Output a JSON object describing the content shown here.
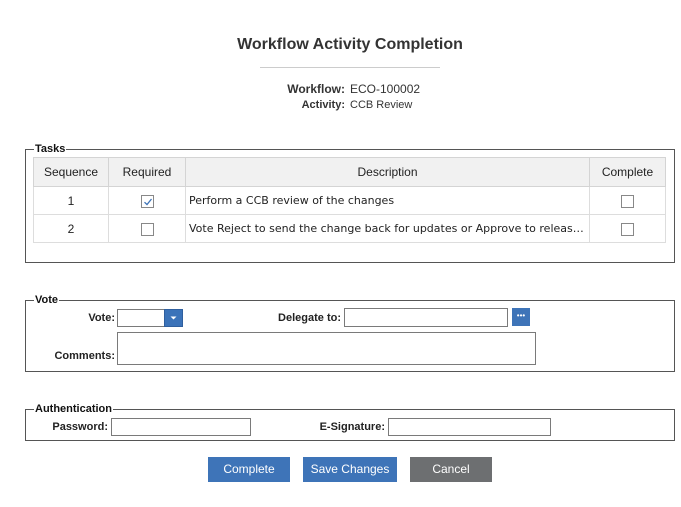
{
  "header": {
    "title": "Workflow Activity Completion",
    "workflow_label": "Workflow:",
    "workflow_value": "ECO-100002",
    "activity_label": "Activity:",
    "activity_value": "CCB Review"
  },
  "tasks": {
    "legend": "Tasks",
    "columns": [
      "Sequence",
      "Required",
      "Description",
      "Complete"
    ],
    "rows": [
      {
        "sequence": "1",
        "required": true,
        "description": "Perform a CCB review of the changes",
        "complete": false
      },
      {
        "sequence": "2",
        "required": false,
        "description": "Vote Reject to send the change back for updates or Approve to release t…",
        "complete": false
      }
    ]
  },
  "vote": {
    "legend": "Vote",
    "vote_label": "Vote:",
    "vote_value": "",
    "delegate_label": "Delegate to:",
    "delegate_value": "",
    "delegate_button_label": "•••",
    "comments_label": "Comments:",
    "comments_value": ""
  },
  "auth": {
    "legend": "Authentication",
    "password_label": "Password:",
    "esignature_label": "E-Signature:"
  },
  "buttons": {
    "complete": "Complete",
    "save": "Save Changes",
    "cancel": "Cancel"
  },
  "colors": {
    "primary_button": "#3e74b8",
    "secondary_button": "#6d6f71"
  }
}
